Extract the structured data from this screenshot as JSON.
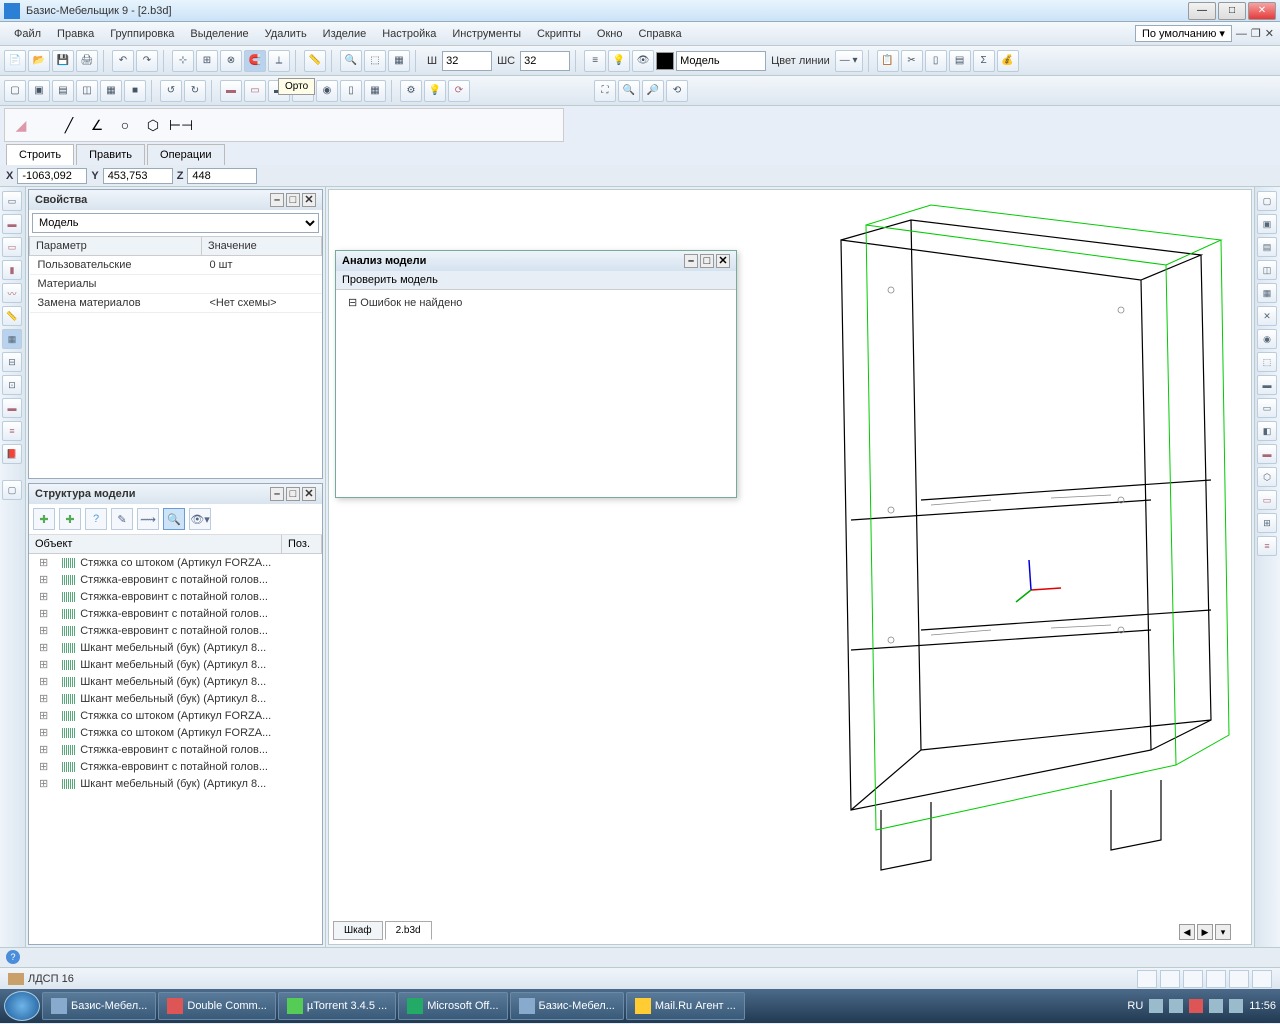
{
  "window": {
    "title": "Базис-Мебельщик 9 - [2.b3d]",
    "preset": "По умолчанию"
  },
  "menu": {
    "items": [
      "Файл",
      "Правка",
      "Группировка",
      "Выделение",
      "Удалить",
      "Изделие",
      "Настройка",
      "Инструменты",
      "Скрипты",
      "Окно",
      "Справка"
    ]
  },
  "toolbar": {
    "w_label": "Ш",
    "w_value": "32",
    "wc_label": "ШС",
    "wc_value": "32",
    "model_label": "Модель",
    "linecolor_label": "Цвет линии",
    "tooltip": "Орто"
  },
  "tabs": {
    "build": "Строить",
    "edit": "Править",
    "ops": "Операции"
  },
  "coords": {
    "x_label": "X",
    "x": "-1063,092",
    "y_label": "Y",
    "y": "453,753",
    "z_label": "Z",
    "z": "448"
  },
  "props": {
    "title": "Свойства",
    "selector": "Модель",
    "col_param": "Параметр",
    "col_value": "Значение",
    "rows": [
      {
        "p": "Пользовательские",
        "v": "0 шт"
      },
      {
        "p": "Материалы",
        "v": ""
      },
      {
        "p": "Замена материалов",
        "v": "<Нет схемы>"
      }
    ]
  },
  "struct": {
    "title": "Структура модели",
    "col_obj": "Объект",
    "col_pos": "Поз.",
    "items": [
      "Стяжка со штоком (Артикул FORZA...",
      "Стяжка-евровинт с потайной голов...",
      "Стяжка-евровинт с потайной голов...",
      "Стяжка-евровинт с потайной голов...",
      "Стяжка-евровинт с потайной голов...",
      "Шкант мебельный (бук) (Артикул 8...",
      "Шкант мебельный (бук) (Артикул 8...",
      "Шкант мебельный (бук) (Артикул 8...",
      "Шкант мебельный (бук) (Артикул 8...",
      "Стяжка со штоком (Артикул FORZA...",
      "Стяжка со штоком (Артикул FORZA...",
      "Стяжка-евровинт с потайной голов...",
      "Стяжка-евровинт с потайной голов...",
      "Шкант мебельный (бук) (Артикул 8..."
    ]
  },
  "analysis": {
    "title": "Анализ модели",
    "check": "Проверить модель",
    "result": "Ошибок не найдено"
  },
  "viewtabs": {
    "tab1": "Шкаф",
    "tab2": "2.b3d"
  },
  "status": {
    "material": "ЛДСП 16"
  },
  "taskbar": {
    "items": [
      "Базис-Мебел...",
      "Double Comm...",
      "µTorrent 3.4.5 ...",
      "Microsoft Off...",
      "Базис-Мебел...",
      "Mail.Ru Агент ..."
    ],
    "lang": "RU",
    "time": "11:56"
  }
}
